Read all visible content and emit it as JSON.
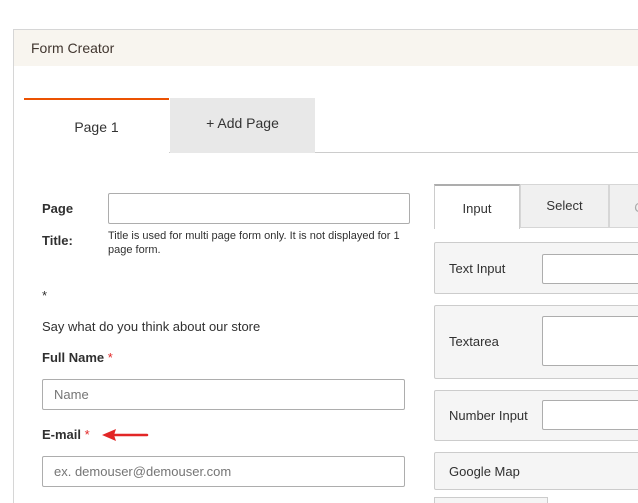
{
  "header": {
    "title": "Form Creator"
  },
  "page_tabs": [
    {
      "label": "Page 1"
    },
    {
      "label": "+ Add Page"
    }
  ],
  "form": {
    "page_title_label_1": "Page",
    "page_title_label_2": "Title:",
    "page_title_value": "",
    "page_title_note": "Title is used for multi page form only. It is not displayed for 1 page form.",
    "asterisk": "*",
    "description": "Say what do you think about our store",
    "full_name_label": "Full Name",
    "full_name_placeholder": "Name",
    "email_label": "E-mail",
    "email_placeholder": "ex. demouser@demouser.com",
    "required_mark": "*"
  },
  "side": {
    "tabs": [
      {
        "label": "Input"
      },
      {
        "label": "Select"
      },
      {
        "label": "C"
      }
    ],
    "items": [
      {
        "label": "Text Input"
      },
      {
        "label": "Textarea"
      },
      {
        "label": "Number Input"
      },
      {
        "label": "Google Map"
      }
    ]
  },
  "colors": {
    "accent": "#eb5202",
    "required": "#e22626",
    "header_bg": "#f8f5ef"
  },
  "icons": {
    "annotation": "red-arrow-icon"
  }
}
